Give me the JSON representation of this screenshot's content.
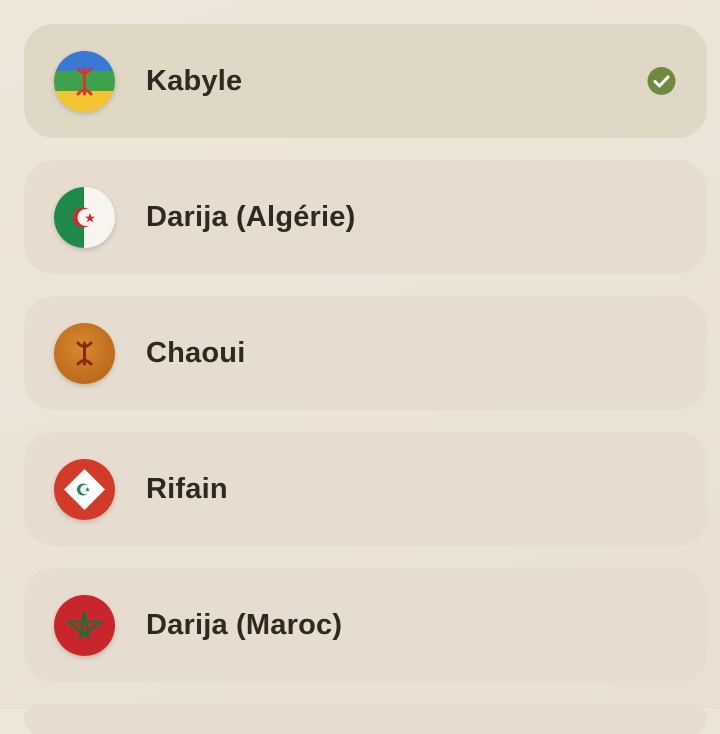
{
  "languages": [
    {
      "label": "Kabyle",
      "flag_icon": "amazigh-flag-icon",
      "selected": true
    },
    {
      "label": "Darija (Algérie)",
      "flag_icon": "algeria-flag-icon",
      "selected": false
    },
    {
      "label": "Chaoui",
      "flag_icon": "chaoui-flag-icon",
      "selected": false
    },
    {
      "label": "Rifain",
      "flag_icon": "rif-flag-icon",
      "selected": false
    },
    {
      "label": "Darija (Maroc)",
      "flag_icon": "morocco-flag-icon",
      "selected": false
    }
  ],
  "colors": {
    "selected_check": "#6e8a3e",
    "item_background": "#e6ddd0",
    "selected_background": "#dfd8c5"
  }
}
